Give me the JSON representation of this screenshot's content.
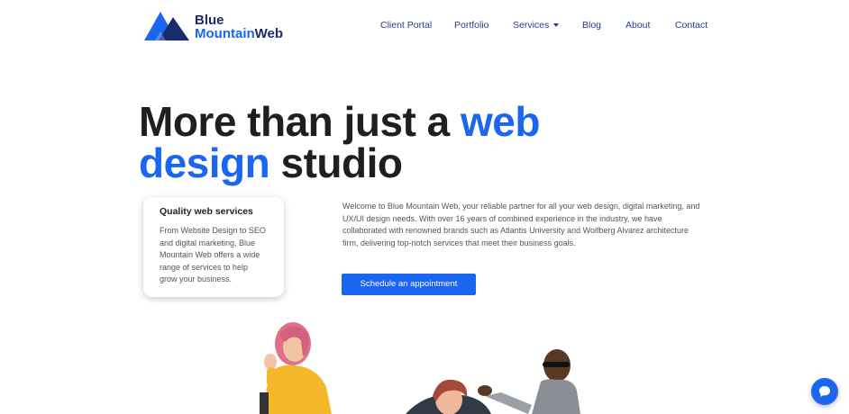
{
  "brand": {
    "line1": "Blue",
    "line2_part1": "Mountain",
    "line2_part2": "Web",
    "logo_icon": "mountain-logo-icon"
  },
  "nav": {
    "items": [
      {
        "label": "Client Portal"
      },
      {
        "label": "Portfolio"
      },
      {
        "label": "Services",
        "has_dropdown": true
      },
      {
        "label": "Blog"
      },
      {
        "label": "About"
      },
      {
        "label": "Contact"
      }
    ]
  },
  "hero": {
    "title_part1": "More than just a ",
    "title_highlight1": "web",
    "title_highlight2": "design",
    "title_part2": " studio"
  },
  "card": {
    "title": "Quality web services",
    "body": "From Website Design to SEO and digital marketing, Blue Mountain Web offers a wide range of services to help grow your business."
  },
  "intro": {
    "text": "Welcome to Blue Mountain Web, your reliable partner for all your web design, digital marketing, and UX/UI design needs. With over 16 years of combined experience in the industry, we have collaborated with renowned brands such as Atlantis University and Wolfberg Alvarez architecture firm, delivering top-notch services that meet their business goals."
  },
  "cta": {
    "label": "Schedule an appointment"
  },
  "chat": {
    "icon": "chat-bubble-icon"
  },
  "colors": {
    "accent": "#1a66f0",
    "navy": "#1a2a6e",
    "text_dark": "#1f1f1f"
  }
}
